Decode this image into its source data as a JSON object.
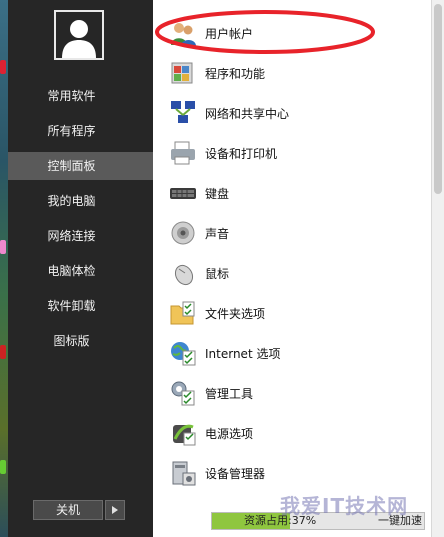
{
  "nav": {
    "items": [
      "常用软件",
      "所有程序",
      "控制面板",
      "我的电脑",
      "网络连接",
      "电脑体检",
      "软件卸载",
      "图标版"
    ],
    "active_index": 2,
    "shutdown_label": "关机"
  },
  "panel": {
    "items": [
      {
        "label": "用户帐户",
        "icon": "users-icon"
      },
      {
        "label": "程序和功能",
        "icon": "programs-icon"
      },
      {
        "label": "网络和共享中心",
        "icon": "network-icon"
      },
      {
        "label": "设备和打印机",
        "icon": "printer-icon"
      },
      {
        "label": "键盘",
        "icon": "keyboard-icon"
      },
      {
        "label": "声音",
        "icon": "speaker-icon"
      },
      {
        "label": "鼠标",
        "icon": "mouse-icon"
      },
      {
        "label": "文件夹选项",
        "icon": "folder-options-icon"
      },
      {
        "label": "Internet 选项",
        "icon": "internet-options-icon"
      },
      {
        "label": "管理工具",
        "icon": "admin-tools-icon"
      },
      {
        "label": "电源选项",
        "icon": "power-options-icon"
      },
      {
        "label": "设备管理器",
        "icon": "device-manager-icon"
      }
    ]
  },
  "status": {
    "usage_text": "资源占用:37%",
    "usage_percent": 37,
    "button_label": "一键加速"
  },
  "watermark": "我爱IT技术网",
  "colors": {
    "highlight": "#e8232a",
    "usage_fill": "#8fc63f",
    "active_nav": "#5a5a5a"
  }
}
